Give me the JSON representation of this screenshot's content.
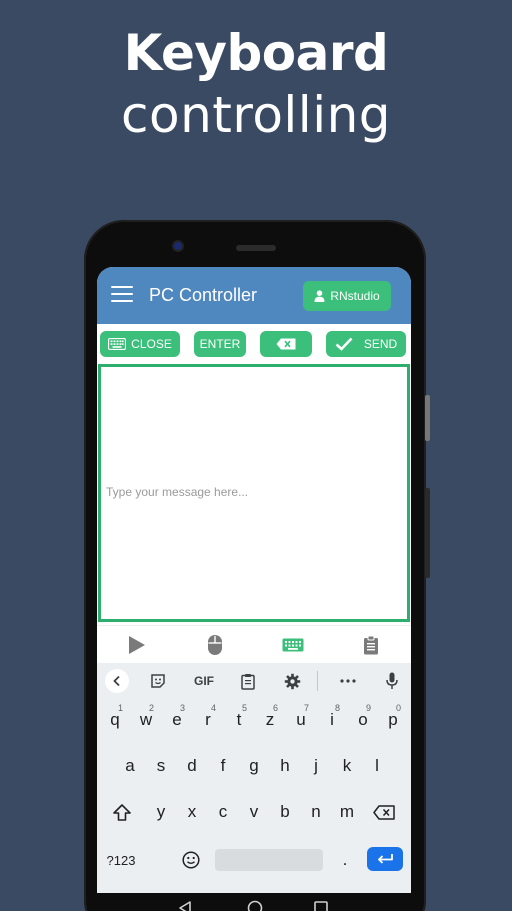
{
  "promo": {
    "line1": "Keyboard",
    "line2": "controlling"
  },
  "appbar": {
    "title": "PC Controller",
    "user_button": "RNstudio"
  },
  "toolbar": {
    "close": "CLOSE",
    "enter": "ENTER",
    "send": "SEND"
  },
  "input": {
    "placeholder": "Type your message here...",
    "value": ""
  },
  "keyboard": {
    "row1": [
      "q",
      "w",
      "e",
      "r",
      "t",
      "z",
      "u",
      "i",
      "o",
      "p"
    ],
    "row1_hints": [
      "1",
      "2",
      "3",
      "4",
      "5",
      "6",
      "7",
      "8",
      "9",
      "0"
    ],
    "row2": [
      "a",
      "s",
      "d",
      "f",
      "g",
      "h",
      "j",
      "k",
      "l"
    ],
    "row3": [
      "y",
      "x",
      "c",
      "v",
      "b",
      "n",
      "m"
    ],
    "symbols_key": "?123",
    "gif_label": "GIF",
    "period": "."
  },
  "colors": {
    "background": "#3b4a63",
    "appbar": "#4f87bf",
    "accent": "#3bbf7a",
    "enter": "#1a73e8"
  }
}
